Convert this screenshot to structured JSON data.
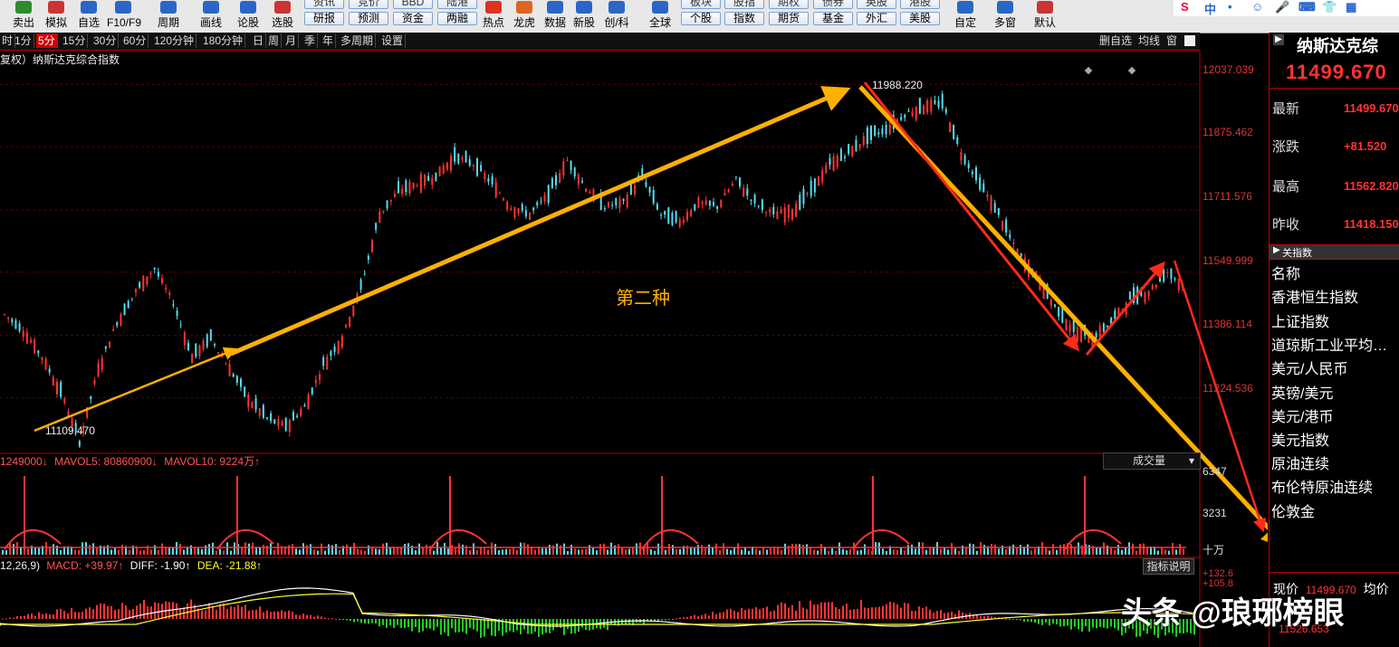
{
  "toolbar": {
    "buttons": [
      {
        "label": "卖出",
        "icon": "sell-icon",
        "color": "#2e8b2e"
      },
      {
        "label": "模拟",
        "icon": "simulate-icon",
        "color": "#cc3333"
      },
      {
        "label": "自选",
        "icon": "star-icon",
        "color": "#2a66c8"
      },
      {
        "label": "F10/F9",
        "icon": "f10-icon",
        "color": "#2a66c8"
      },
      {
        "label": "周期",
        "icon": "clock-icon",
        "color": "#2a66c8"
      },
      {
        "label": "画线",
        "icon": "pencil-icon",
        "color": "#2a66c8"
      },
      {
        "label": "论股",
        "icon": "discuss-icon",
        "color": "#2a66c8"
      },
      {
        "label": "选股",
        "icon": "magnifier-icon",
        "color": "#cc3333"
      }
    ],
    "pills_top": [
      "资讯",
      "竞价",
      "BBD",
      "陆港"
    ],
    "pills_bottom": [
      "研报",
      "预测",
      "资金",
      "两融"
    ],
    "mid_buttons": [
      {
        "label": "热点",
        "icon": "hot-icon",
        "color": "#dd3322"
      },
      {
        "label": "龙虎",
        "icon": "dragon-icon",
        "color": "#dd6622"
      },
      {
        "label": "数据",
        "icon": "pe-icon",
        "color": "#2a66c8"
      },
      {
        "label": "新股",
        "icon": "new-stock-icon",
        "color": "#2a66c8"
      },
      {
        "label": "创/科",
        "icon": "star-market-icon",
        "color": "#2a66c8"
      },
      {
        "label": "全球",
        "icon": "globe-icon",
        "color": "#2a66c8"
      }
    ],
    "pills2_top": [
      "板块",
      "股指",
      "期权",
      "债券",
      "英股",
      "港股"
    ],
    "pills2_bottom": [
      "个股",
      "指数",
      "期货",
      "基金",
      "外汇",
      "美股"
    ],
    "right_buttons": [
      {
        "label": "自定",
        "icon": "custom-icon",
        "color": "#2a66c8"
      },
      {
        "label": "多窗",
        "icon": "multi-window-icon",
        "color": "#2a66c8"
      },
      {
        "label": "默认",
        "icon": "default-layout-icon",
        "color": "#cc3333"
      }
    ],
    "brand_chars": [
      "S",
      "中",
      "•",
      "☺",
      "🎤",
      "⌨",
      "👕",
      "▦"
    ]
  },
  "period_bar": {
    "items": [
      "时",
      "1分",
      "5分",
      "15分",
      "30分",
      "60分",
      "120分钟",
      "180分钟",
      "日",
      "周",
      "月",
      "季",
      "年",
      "多周期",
      "设置"
    ],
    "active_index": 2,
    "right_items": [
      "删自选",
      "均线",
      "窗"
    ]
  },
  "chart": {
    "title": "复权）纳斯达克综合指数",
    "annotation": "第二种",
    "high_label": "11988.220",
    "low_label": "11109.470",
    "price_axis": [
      "12037.039",
      "11875.462",
      "11711.576",
      "11549.999",
      "11386.114",
      "11224.536"
    ],
    "volume_label_parts": [
      "1249000↓",
      "MAVOL5: 80860900↓",
      "MAVOL10: 9224万↑"
    ],
    "volume_dropdown": "成交量",
    "volume_axis": [
      "6347",
      "3231",
      "十万"
    ],
    "macd_label_parts": [
      "12,26,9)",
      "MACD: +39.97↑",
      "DIFF: -1.90↑",
      "DEA: -21.88↑"
    ],
    "macd_help": "指标说明",
    "macd_axis": [
      "+132.6",
      "+105.8"
    ],
    "colors": {
      "up": "#ff3333",
      "down": "#55ddee",
      "arrow_red": "#ff2a1a",
      "arrow_gold": "#ffb000",
      "axis_red": "#dd3333",
      "grid": "#5a0000",
      "ma_white": "#ffffff",
      "ma_yellow": "#ffff33",
      "macd_green": "#22cc22"
    }
  },
  "chart_data": {
    "type": "line",
    "title": "纳斯达克综合指数",
    "xlabel": "",
    "ylabel": "",
    "ylim": [
      11080,
      12080
    ],
    "y_ticks": [
      12037.039,
      11875.462,
      11711.576,
      11549.999,
      11386.114,
      11224.536
    ],
    "series": [
      {
        "values": [
          11440,
          11400,
          11330,
          11240,
          11109,
          11300,
          11420,
          11500,
          11560,
          11470,
          11330,
          11380,
          11300,
          11220,
          11170,
          11150,
          11200,
          11310,
          11380,
          11510,
          11700,
          11760,
          11780,
          11800,
          11850,
          11830,
          11780,
          11720,
          11700,
          11750,
          11840,
          11770,
          11720,
          11730,
          11800,
          11700,
          11680,
          11730,
          11720,
          11790,
          11730,
          11700,
          11710,
          11760,
          11830,
          11860,
          11900,
          11920,
          11960,
          11980,
          11988,
          11860,
          11780,
          11700,
          11600,
          11540,
          11460,
          11400,
          11380,
          11420,
          11480,
          11500,
          11550,
          11510
        ]
      }
    ],
    "annotations": [
      {
        "text": "11988.220",
        "value": 11988.22
      },
      {
        "text": "11109.470",
        "value": 11109.47
      }
    ]
  },
  "sidebar": {
    "title": "纳斯达克综",
    "price": "11499.670",
    "stats": [
      {
        "label": "最新",
        "value": "11499.670"
      },
      {
        "label": "涨跌",
        "value": "+81.520"
      },
      {
        "label": "最高",
        "value": "11562.820"
      },
      {
        "label": "昨收",
        "value": "11418.150"
      }
    ],
    "section_label": "关指数",
    "header": "名称",
    "related": [
      "香港恒生指数",
      "上证指数",
      "道琼斯工业平均…",
      "美元/人民币",
      "英镑/美元",
      "美元/港币",
      "美元指数",
      "原油连续",
      "布伦特原油连续",
      "伦敦金"
    ],
    "bottom_parts": [
      "现价",
      "11499.670",
      "均价"
    ],
    "bottom_price": "11526.653"
  },
  "watermark": "头条 @琅琊榜眼"
}
